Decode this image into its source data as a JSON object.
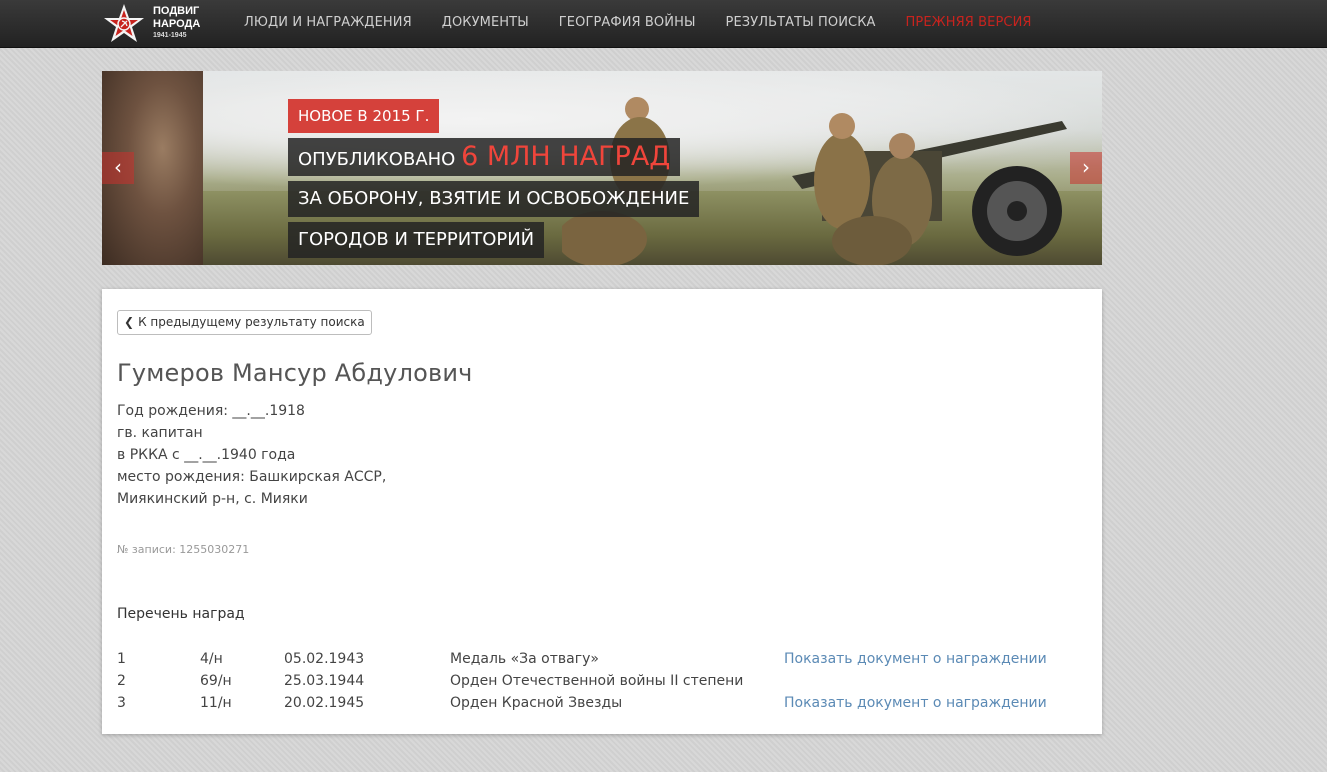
{
  "header": {
    "logo": {
      "line1": "ПОДВИГ",
      "line2": "НАРОДА",
      "years": "1941-1945"
    },
    "nav": [
      {
        "label": "ЛЮДИ И НАГРАЖДЕНИЯ"
      },
      {
        "label": "ДОКУМЕНТЫ"
      },
      {
        "label": "ГЕОГРАФИЯ ВОЙНЫ"
      },
      {
        "label": "РЕЗУЛЬТАТЫ ПОИСКА"
      },
      {
        "label": "ПРЕЖНЯЯ ВЕРСИЯ",
        "color": "#c8231e"
      }
    ]
  },
  "banner": {
    "badge": "НОВОЕ В 2015 Г.",
    "line1_prefix": "ОПУБЛИКОВАНО ",
    "line1_accent": "6 МЛН НАГРАД",
    "line2": "ЗА ОБОРОНУ, ВЗЯТИЕ И ОСВОБОЖДЕНИЕ",
    "line3": "ГОРОДОВ И ТЕРРИТОРИЙ",
    "prev_icon": "chevron-left-icon",
    "next_icon": "chevron-right-icon"
  },
  "person": {
    "back_label": "К предыдущему результату поиска",
    "name": "Гумеров Мансур Абдулович",
    "birth_year": "Год рождения: __.__.1918",
    "rank": "гв. капитан",
    "service": "в РККА с __.__.1940 года",
    "birthplace_1": "место рождения: Башкирская АССР,",
    "birthplace_2": "Миякинский р-н, с. Мияки",
    "record": "№ записи: 1255030271"
  },
  "awards": {
    "title": "Перечень наград",
    "rows": [
      {
        "num": "1",
        "order": "4/н",
        "date": "05.02.1943",
        "name": "Медаль «За отвагу»",
        "link": "Показать документ о награждении"
      },
      {
        "num": "2",
        "order": "69/н",
        "date": "25.03.1944",
        "name": "Орден Отечественной войны II степени",
        "link": ""
      },
      {
        "num": "3",
        "order": "11/н",
        "date": "20.02.1945",
        "name": "Орден Красной Звезды",
        "link": "Показать документ о награждении"
      }
    ]
  },
  "colors": {
    "accent": "#d5413b",
    "link": "#5b8ab5",
    "nav_bg": "#2b2b2b"
  }
}
